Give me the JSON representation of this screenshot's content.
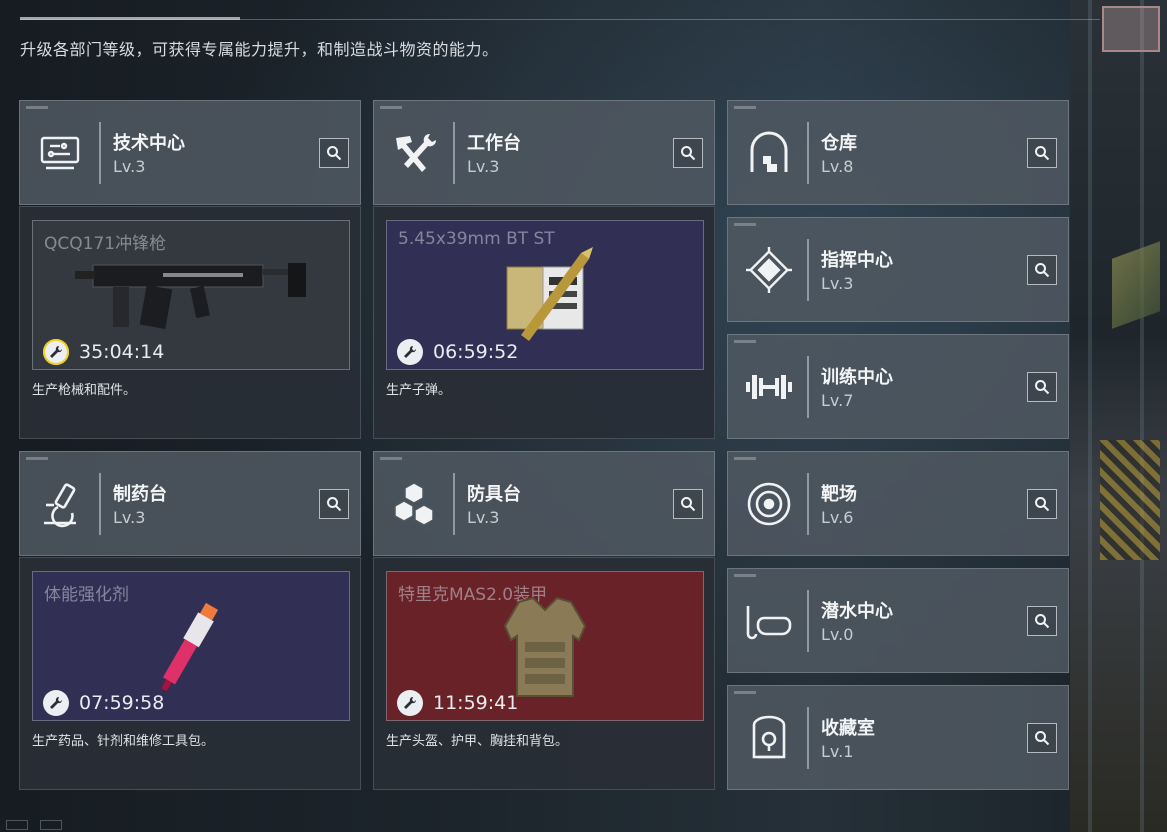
{
  "header": {
    "subtitle": "升级各部门等级，可获得专属能力提升，和制造战斗物资的能力。"
  },
  "departments": [
    {
      "name": "技术中心",
      "level": "Lv.3",
      "icon": "tech-center-icon"
    },
    {
      "name": "工作台",
      "level": "Lv.3",
      "icon": "workbench-icon"
    },
    {
      "name": "仓库",
      "level": "Lv.8",
      "icon": "warehouse-icon"
    },
    {
      "name": "指挥中心",
      "level": "Lv.3",
      "icon": "command-center-icon"
    },
    {
      "name": "训练中心",
      "level": "Lv.7",
      "icon": "training-center-icon"
    },
    {
      "name": "制药台",
      "level": "Lv.3",
      "icon": "pharmacy-icon"
    },
    {
      "name": "防具台",
      "level": "Lv.3",
      "icon": "armor-bench-icon"
    },
    {
      "name": "靶场",
      "level": "Lv.6",
      "icon": "shooting-range-icon"
    },
    {
      "name": "潜水中心",
      "level": "Lv.0",
      "icon": "diving-center-icon"
    },
    {
      "name": "收藏室",
      "level": "Lv.1",
      "icon": "collection-room-icon"
    }
  ],
  "production": [
    {
      "item": "QCQ171冲锋枪",
      "timer": "35:04:14",
      "description": "生产枪械和配件。",
      "bg": "#34393f"
    },
    {
      "item": "5.45x39mm BT ST",
      "timer": "06:59:52",
      "description": "生产子弹。",
      "bg": "#322f55"
    },
    {
      "item": "体能强化剂",
      "timer": "07:59:58",
      "description": "生产药品、针剂和维修工具包。",
      "bg": "#322f55"
    },
    {
      "item": "特里克MAS2.0装甲",
      "timer": "11:59:41",
      "description": "生产头盔、护甲、胸挂和背包。",
      "bg": "#6a2229"
    }
  ],
  "colors": {
    "card_bg": "#4e5861",
    "accent_purple": "#322f55",
    "accent_red": "#6a2229",
    "timer_ring": "#f2d31a"
  }
}
